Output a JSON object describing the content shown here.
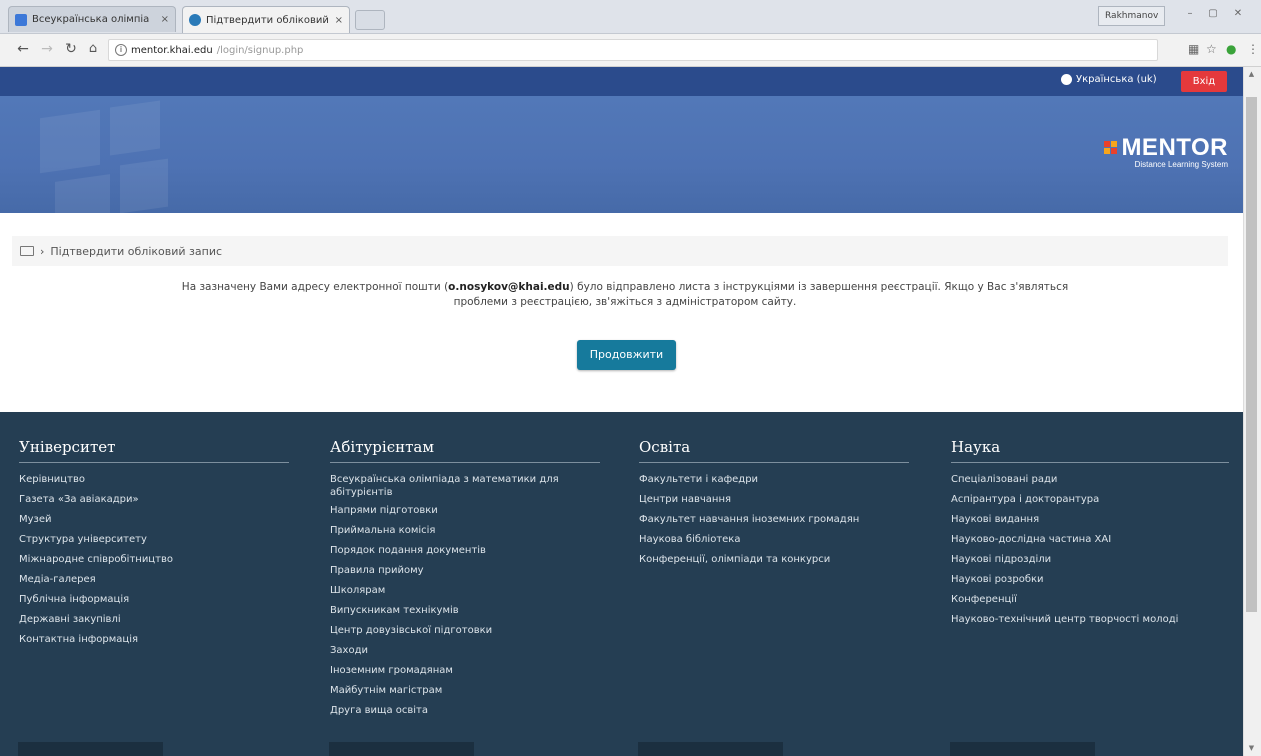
{
  "browser": {
    "tabs": [
      {
        "title": "Всеукраїнська олімпіа",
        "close": "×",
        "favicon_color": "#3c78d8"
      },
      {
        "title": "Підтвердити обліковий",
        "close": "×",
        "favicon_color": "#2a7ab8"
      }
    ],
    "user_chip": "Rakhmanov",
    "window_buttons": [
      "–",
      "▢",
      "✕"
    ],
    "url_host": "mentor.khai.edu",
    "url_path": "/login/signup.php"
  },
  "site": {
    "language": "Українська (uk)",
    "login_label": "Вхід",
    "logo": {
      "word": "MENTOR",
      "subtitle": "Distance Learning System"
    },
    "breadcrumb": {
      "separator": "›",
      "current": "Підтвердити обліковий запис"
    },
    "message": {
      "before": "На зазначену Вами адресу електронної пошти (",
      "email": "o.nosykov@khai.edu",
      "after": ") було відправлено листа з інструкціями із завершення реєстрації. Якщо у Вас з'являться проблеми з реєстрацією, зв'яжіться з адміністратором сайту."
    },
    "continue_label": "Продовжити"
  },
  "footer": {
    "columns": [
      {
        "title": "Університет",
        "items": [
          "Керівництво",
          "Газета «За авіакадри»",
          "Музей",
          "Структура університету",
          "Міжнародне співробітництво",
          "Медіа-галерея",
          "Публічна інформація",
          "Державні закупівлі",
          "Контактна інформація"
        ]
      },
      {
        "title": "Абітурієнтам",
        "items": [
          "Всеукраїнська олімпіада з математики для абітурієнтів",
          "Напрями підготовки",
          "Приймальна комісія",
          "Порядок подання документів",
          "Правила прийому",
          "Школярам",
          "Випускникам технікумів",
          "Центр довузівської підготовки",
          "Заходи",
          "Іноземним громадянам",
          "Майбутнім магістрам",
          "Друга вища освіта"
        ]
      },
      {
        "title": "Освіта",
        "items": [
          "Факультети і кафедри",
          "Центри навчання",
          "Факультет навчання іноземних громадян",
          "Наукова бібліотека",
          "Конференції, олімпіади та конкурси"
        ]
      },
      {
        "title": "Наука",
        "items": [
          "Спеціалізовані ради",
          "Аспірантура і докторантура",
          "Наукові видання",
          "Науково-дослідна частина ХАІ",
          "Наукові підрозділи",
          "Наукові розробки",
          "Конференції",
          "Науково-технічний центр творчості молоді"
        ]
      }
    ]
  }
}
